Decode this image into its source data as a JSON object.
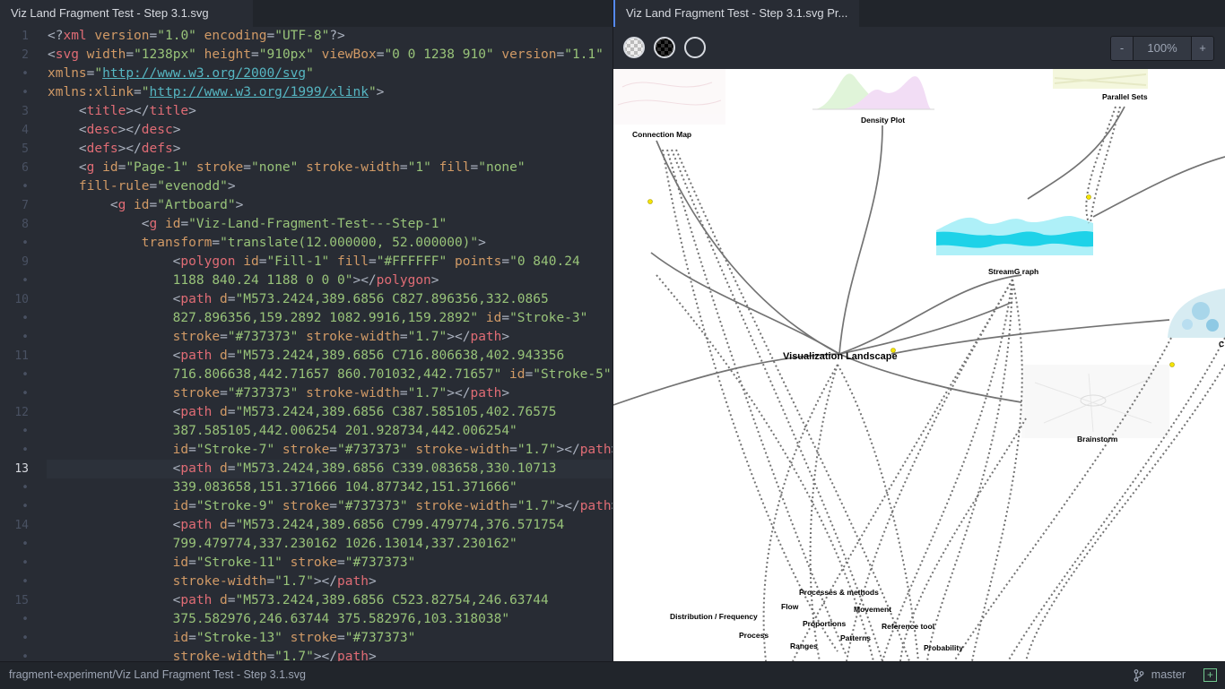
{
  "tabs": {
    "editor": "Viz Land Fragment Test - Step 3.1.svg",
    "preview": "Viz Land Fragment Test - Step 3.1.svg Pr..."
  },
  "editor": {
    "current_line": "13",
    "lines": [
      {
        "num": "1",
        "seg": [
          [
            "p",
            "<?"
          ],
          [
            "t",
            "xml"
          ],
          [
            "a",
            " version"
          ],
          [
            "p",
            "="
          ],
          [
            "s",
            "\"1.0\""
          ],
          [
            "a",
            " encoding"
          ],
          [
            "p",
            "="
          ],
          [
            "s",
            "\"UTF-8\""
          ],
          [
            "p",
            "?>"
          ]
        ]
      },
      {
        "num": "2",
        "seg": [
          [
            "p",
            "<"
          ],
          [
            "t",
            "svg"
          ],
          [
            "a",
            " width"
          ],
          [
            "p",
            "="
          ],
          [
            "s",
            "\"1238px\""
          ],
          [
            "a",
            " height"
          ],
          [
            "p",
            "="
          ],
          [
            "s",
            "\"910px\""
          ],
          [
            "a",
            " viewBox"
          ],
          [
            "p",
            "="
          ],
          [
            "s",
            "\"0 0 1238 910\""
          ],
          [
            "a",
            " version"
          ],
          [
            "p",
            "="
          ],
          [
            "s",
            "\"1.1\""
          ]
        ]
      },
      {
        "num": "•",
        "seg": [
          [
            "a",
            "xmlns"
          ],
          [
            "p",
            "="
          ],
          [
            "s",
            "\""
          ],
          [
            "u",
            "http://www.w3.org/2000/svg"
          ],
          [
            "s",
            "\""
          ]
        ]
      },
      {
        "num": "•",
        "seg": [
          [
            "a",
            "xmlns:xlink"
          ],
          [
            "p",
            "="
          ],
          [
            "s",
            "\""
          ],
          [
            "u",
            "http://www.w3.org/1999/xlink"
          ],
          [
            "s",
            "\""
          ],
          [
            "p",
            ">"
          ]
        ]
      },
      {
        "num": "3",
        "seg": [
          [
            "p",
            "    <"
          ],
          [
            "t",
            "title"
          ],
          [
            "p",
            "></"
          ],
          [
            "t",
            "title"
          ],
          [
            "p",
            ">"
          ]
        ]
      },
      {
        "num": "4",
        "seg": [
          [
            "p",
            "    <"
          ],
          [
            "t",
            "desc"
          ],
          [
            "p",
            "></"
          ],
          [
            "t",
            "desc"
          ],
          [
            "p",
            ">"
          ]
        ]
      },
      {
        "num": "5",
        "seg": [
          [
            "p",
            "    <"
          ],
          [
            "t",
            "defs"
          ],
          [
            "p",
            "></"
          ],
          [
            "t",
            "defs"
          ],
          [
            "p",
            ">"
          ]
        ]
      },
      {
        "num": "6",
        "seg": [
          [
            "p",
            "    <"
          ],
          [
            "t",
            "g"
          ],
          [
            "a",
            " id"
          ],
          [
            "p",
            "="
          ],
          [
            "s",
            "\"Page-1\""
          ],
          [
            "a",
            " stroke"
          ],
          [
            "p",
            "="
          ],
          [
            "s",
            "\"none\""
          ],
          [
            "a",
            " stroke-width"
          ],
          [
            "p",
            "="
          ],
          [
            "s",
            "\"1\""
          ],
          [
            "a",
            " fill"
          ],
          [
            "p",
            "="
          ],
          [
            "s",
            "\"none\""
          ]
        ]
      },
      {
        "num": "•",
        "seg": [
          [
            "a",
            "    fill-rule"
          ],
          [
            "p",
            "="
          ],
          [
            "s",
            "\"evenodd\""
          ],
          [
            "p",
            ">"
          ]
        ]
      },
      {
        "num": "7",
        "seg": [
          [
            "p",
            "        <"
          ],
          [
            "t",
            "g"
          ],
          [
            "a",
            " id"
          ],
          [
            "p",
            "="
          ],
          [
            "s",
            "\"Artboard\""
          ],
          [
            "p",
            ">"
          ]
        ]
      },
      {
        "num": "8",
        "seg": [
          [
            "p",
            "            <"
          ],
          [
            "t",
            "g"
          ],
          [
            "a",
            " id"
          ],
          [
            "p",
            "="
          ],
          [
            "s",
            "\"Viz-Land-Fragment-Test---Step-1\""
          ]
        ]
      },
      {
        "num": "•",
        "seg": [
          [
            "a",
            "            transform"
          ],
          [
            "p",
            "="
          ],
          [
            "s",
            "\"translate(12.000000, 52.000000)\""
          ],
          [
            "p",
            ">"
          ]
        ]
      },
      {
        "num": "9",
        "seg": [
          [
            "p",
            "                <"
          ],
          [
            "t",
            "polygon"
          ],
          [
            "a",
            " id"
          ],
          [
            "p",
            "="
          ],
          [
            "s",
            "\"Fill-1\""
          ],
          [
            "a",
            " fill"
          ],
          [
            "p",
            "="
          ],
          [
            "s",
            "\"#FFFFFF\""
          ],
          [
            "a",
            " points"
          ],
          [
            "p",
            "="
          ],
          [
            "s",
            "\"0 840.24"
          ]
        ]
      },
      {
        "num": "•",
        "seg": [
          [
            "s",
            "                1188 840.24 1188 0 0 0\""
          ],
          [
            "p",
            "></"
          ],
          [
            "t",
            "polygon"
          ],
          [
            "p",
            ">"
          ]
        ]
      },
      {
        "num": "10",
        "seg": [
          [
            "p",
            "                <"
          ],
          [
            "t",
            "path"
          ],
          [
            "a",
            " d"
          ],
          [
            "p",
            "="
          ],
          [
            "s",
            "\"M573.2424,389.6856 C827.896356,332.0865"
          ]
        ]
      },
      {
        "num": "•",
        "seg": [
          [
            "s",
            "                827.896356,159.2892 1082.9916,159.2892\""
          ],
          [
            "a",
            " id"
          ],
          [
            "p",
            "="
          ],
          [
            "s",
            "\"Stroke-3\""
          ]
        ]
      },
      {
        "num": "•",
        "seg": [
          [
            "a",
            "                stroke"
          ],
          [
            "p",
            "="
          ],
          [
            "s",
            "\"#737373\""
          ],
          [
            "a",
            " stroke-width"
          ],
          [
            "p",
            "="
          ],
          [
            "s",
            "\"1.7\""
          ],
          [
            "p",
            "></"
          ],
          [
            "t",
            "path"
          ],
          [
            "p",
            ">"
          ]
        ]
      },
      {
        "num": "11",
        "seg": [
          [
            "p",
            "                <"
          ],
          [
            "t",
            "path"
          ],
          [
            "a",
            " d"
          ],
          [
            "p",
            "="
          ],
          [
            "s",
            "\"M573.2424,389.6856 C716.806638,402.943356"
          ]
        ]
      },
      {
        "num": "•",
        "seg": [
          [
            "s",
            "                716.806638,442.71657 860.701032,442.71657\""
          ],
          [
            "a",
            " id"
          ],
          [
            "p",
            "="
          ],
          [
            "s",
            "\"Stroke-5\""
          ]
        ]
      },
      {
        "num": "•",
        "seg": [
          [
            "a",
            "                stroke"
          ],
          [
            "p",
            "="
          ],
          [
            "s",
            "\"#737373\""
          ],
          [
            "a",
            " stroke-width"
          ],
          [
            "p",
            "="
          ],
          [
            "s",
            "\"1.7\""
          ],
          [
            "p",
            "></"
          ],
          [
            "t",
            "path"
          ],
          [
            "p",
            ">"
          ]
        ]
      },
      {
        "num": "12",
        "seg": [
          [
            "p",
            "                <"
          ],
          [
            "t",
            "path"
          ],
          [
            "a",
            " d"
          ],
          [
            "p",
            "="
          ],
          [
            "s",
            "\"M573.2424,389.6856 C387.585105,402.76575"
          ]
        ]
      },
      {
        "num": "•",
        "seg": [
          [
            "s",
            "                387.585105,442.006254 201.928734,442.006254\""
          ]
        ]
      },
      {
        "num": "•",
        "seg": [
          [
            "a",
            "                id"
          ],
          [
            "p",
            "="
          ],
          [
            "s",
            "\"Stroke-7\""
          ],
          [
            "a",
            " stroke"
          ],
          [
            "p",
            "="
          ],
          [
            "s",
            "\"#737373\""
          ],
          [
            "a",
            " stroke-width"
          ],
          [
            "p",
            "="
          ],
          [
            "s",
            "\"1.7\""
          ],
          [
            "p",
            "></"
          ],
          [
            "t",
            "path"
          ],
          [
            "p",
            ">"
          ]
        ]
      },
      {
        "num": "13",
        "seg": [
          [
            "p",
            "                <"
          ],
          [
            "t",
            "path"
          ],
          [
            "a",
            " d"
          ],
          [
            "p",
            "="
          ],
          [
            "s",
            "\"M573.2424,389.6856 C339.083658,330.10713"
          ]
        ]
      },
      {
        "num": "•",
        "seg": [
          [
            "s",
            "                339.083658,151.371666 104.877342,151.371666\""
          ]
        ]
      },
      {
        "num": "•",
        "seg": [
          [
            "a",
            "                id"
          ],
          [
            "p",
            "="
          ],
          [
            "s",
            "\"Stroke-9\""
          ],
          [
            "a",
            " stroke"
          ],
          [
            "p",
            "="
          ],
          [
            "s",
            "\"#737373\""
          ],
          [
            "a",
            " stroke-width"
          ],
          [
            "p",
            "="
          ],
          [
            "s",
            "\"1.7\""
          ],
          [
            "p",
            "></"
          ],
          [
            "t",
            "path"
          ],
          [
            "p",
            ">"
          ]
        ]
      },
      {
        "num": "14",
        "seg": [
          [
            "p",
            "                <"
          ],
          [
            "t",
            "path"
          ],
          [
            "a",
            " d"
          ],
          [
            "p",
            "="
          ],
          [
            "s",
            "\"M573.2424,389.6856 C799.479774,376.571754"
          ]
        ]
      },
      {
        "num": "•",
        "seg": [
          [
            "s",
            "                799.479774,337.230162 1026.13014,337.230162\""
          ]
        ]
      },
      {
        "num": "•",
        "seg": [
          [
            "a",
            "                id"
          ],
          [
            "p",
            "="
          ],
          [
            "s",
            "\"Stroke-11\""
          ],
          [
            "a",
            " stroke"
          ],
          [
            "p",
            "="
          ],
          [
            "s",
            "\"#737373\""
          ]
        ]
      },
      {
        "num": "•",
        "seg": [
          [
            "a",
            "                stroke-width"
          ],
          [
            "p",
            "="
          ],
          [
            "s",
            "\"1.7\""
          ],
          [
            "p",
            "></"
          ],
          [
            "t",
            "path"
          ],
          [
            "p",
            ">"
          ]
        ]
      },
      {
        "num": "15",
        "seg": [
          [
            "p",
            "                <"
          ],
          [
            "t",
            "path"
          ],
          [
            "a",
            " d"
          ],
          [
            "p",
            "="
          ],
          [
            "s",
            "\"M573.2424,389.6856 C523.82754,246.63744"
          ]
        ]
      },
      {
        "num": "•",
        "seg": [
          [
            "s",
            "                375.582976,246.63744 375.582976,103.318038\""
          ]
        ]
      },
      {
        "num": "•",
        "seg": [
          [
            "a",
            "                id"
          ],
          [
            "p",
            "="
          ],
          [
            "s",
            "\"Stroke-13\""
          ],
          [
            "a",
            " stroke"
          ],
          [
            "p",
            "="
          ],
          [
            "s",
            "\"#737373\""
          ]
        ]
      },
      {
        "num": "•",
        "seg": [
          [
            "a",
            "                stroke-width"
          ],
          [
            "p",
            "="
          ],
          [
            "s",
            "\"1.7\""
          ],
          [
            "p",
            "></"
          ],
          [
            "t",
            "path"
          ],
          [
            "p",
            ">"
          ]
        ]
      }
    ]
  },
  "preview": {
    "zoom_out": "-",
    "zoom_level": "100%",
    "zoom_in": "+",
    "labels": {
      "connection_map": "Connection Map",
      "density_plot": "Density Plot",
      "parallel_sets": "Parallel Sets",
      "streamgraph": "StreamG raph",
      "visualization_landscape": "Visualization Landscape",
      "brainstorm": "Brainstorm",
      "processes_methods": "Processes & methods",
      "flow": "Flow",
      "movement": "Movement",
      "distribution_frequency": "Distribution / Frequency",
      "proportions": "Proportions",
      "reference_tool": "Reference tool",
      "process": "Process",
      "patterns": "Patterns",
      "ranges": "Ranges",
      "probability": "Probability",
      "cut_c": "C"
    }
  },
  "status": {
    "path": "fragment-experiment/Viz Land Fragment Test - Step 3.1.svg",
    "branch": "master"
  },
  "colors": {
    "tag": "#e06c75",
    "attr": "#d19a66",
    "string": "#98c379",
    "url": "#56b6c2",
    "stroke": "#737373",
    "stream": "#1ed2e8",
    "node": "#f5e400"
  }
}
